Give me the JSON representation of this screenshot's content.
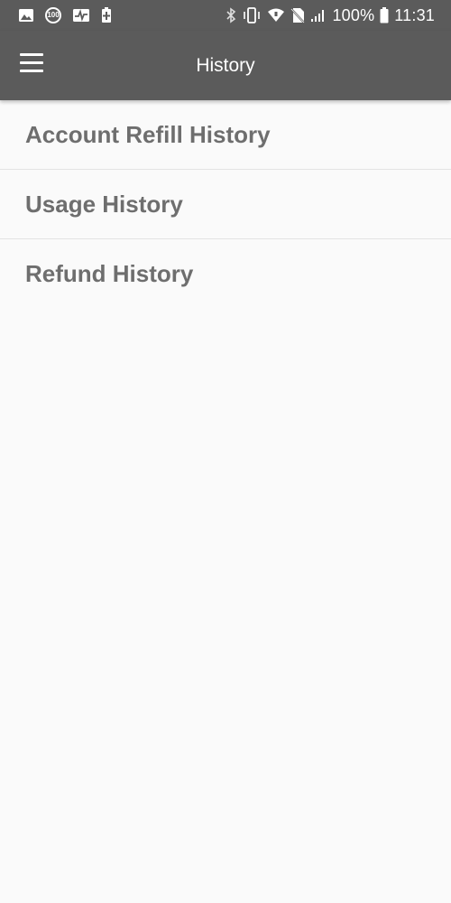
{
  "status_bar": {
    "left_icons": [
      "image-icon",
      "badge-100-icon",
      "activity-icon",
      "battery-saver-icon"
    ],
    "badge_text": "100",
    "right_icons": [
      "bluetooth-icon",
      "vibrate-icon",
      "wifi-icon",
      "no-sim-icon",
      "signal-icon",
      "battery-icon"
    ],
    "battery_percent": "100%",
    "time": "11:31"
  },
  "app_bar": {
    "title": "History",
    "menu_icon": "hamburger-menu-icon"
  },
  "list": {
    "items": [
      {
        "label": "Account Refill History"
      },
      {
        "label": "Usage History"
      },
      {
        "label": "Refund History"
      }
    ]
  },
  "colors": {
    "app_bar": "#5b5b5b",
    "background": "#fafafa",
    "item_text": "#6e6e6e",
    "divider": "#e3e3e3"
  }
}
